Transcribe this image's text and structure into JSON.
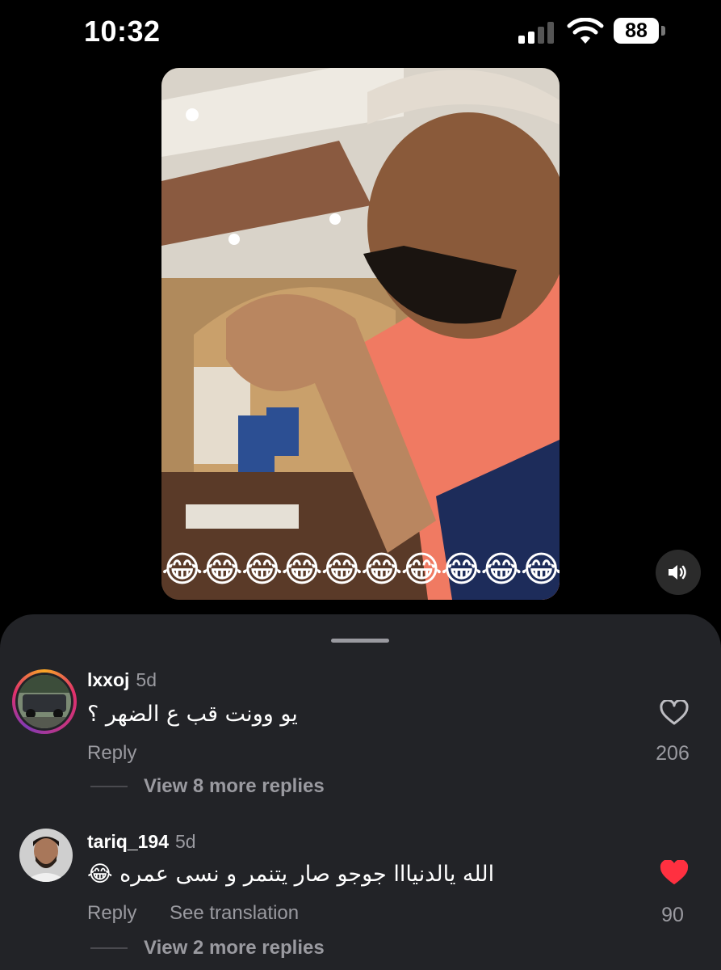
{
  "status_bar": {
    "time": "10:32",
    "battery": "88",
    "icons": [
      "signal-icon",
      "wifi-icon",
      "battery-icon"
    ]
  },
  "video": {
    "overlay_emoji": "😂😂😂😂😂😂😂😂😂😂",
    "sound_icon": "speaker-icon"
  },
  "comments": [
    {
      "username": "lxxoj",
      "time": "5d",
      "text": "يو وونت قب ع الضهر ؟",
      "reply_label": "Reply",
      "likes": "206",
      "liked": false,
      "view_replies": "View 8 more replies"
    },
    {
      "username": "tariq_194",
      "time": "5d",
      "text": "الله يالدنيااا جوجو صار يتنمر و نسى عمره 😂",
      "reply_label": "Reply",
      "translate_label": "See translation",
      "likes": "90",
      "liked": true,
      "view_replies": "View 2 more replies"
    }
  ],
  "colors": {
    "sheet_bg": "#222327",
    "secondary_text": "#9a9aa0",
    "like_red": "#ff3040"
  }
}
